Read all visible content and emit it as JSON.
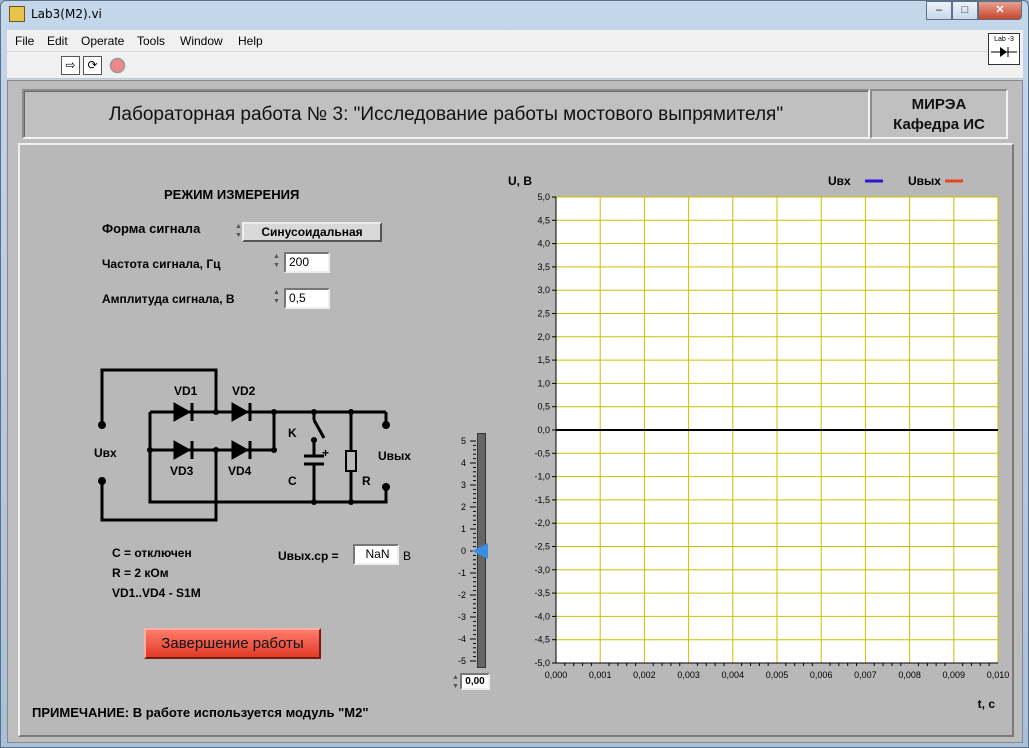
{
  "window": {
    "title": "Lab3(M2).vi",
    "min": "–",
    "max": "□",
    "close": "✕"
  },
  "menu": [
    "File",
    "Edit",
    "Operate",
    "Tools",
    "Window",
    "Help"
  ],
  "vi_icon": "Lab -3",
  "header": {
    "title": "Лабораторная работа № 3: \"Исследование работы мостового выпрямителя\"",
    "org_line1": "МИРЭА",
    "org_line2": "Кафедра ИС"
  },
  "controls": {
    "mode_title": "РЕЖИМ ИЗМЕРЕНИЯ",
    "waveform_label": "Форма сигнала",
    "waveform_value": "Синусоидальная",
    "freq_label": "Частота сигнала, Гц",
    "freq_value": "200",
    "amp_label": "Амплитуда сигнала, В",
    "amp_value": "0,5"
  },
  "circuit": {
    "vd1": "VD1",
    "vd2": "VD2",
    "vd3": "VD3",
    "vd4": "VD4",
    "k": "K",
    "c": "C",
    "r": "R",
    "plus": "+",
    "uin": "Uвх",
    "uout": "Uвых"
  },
  "params": {
    "c_line": "C =   отключен",
    "r_line": "R = 2 кОм",
    "vd_line": "VD1..VD4 - S1M"
  },
  "uavg": {
    "label": "Uвых.ср =",
    "value": "NaN",
    "unit": "B"
  },
  "stop_button": "Завершение работы",
  "note": "ПРИМЕЧАНИЕ: В работе используется модуль \"M2\"",
  "slider": {
    "labels": [
      "5",
      "4",
      "3",
      "2",
      "1",
      "0",
      "-1",
      "-2",
      "-3",
      "-4",
      "-5"
    ],
    "value": 0,
    "digital": "0,00"
  },
  "chart_data": {
    "type": "line",
    "ylabel": "U, B",
    "xlabel": "t, c",
    "ylim": [
      -5.0,
      5.0
    ],
    "xlim": [
      0.0,
      0.01
    ],
    "y_ticks": [
      "5,0",
      "4,5",
      "4,0",
      "3,5",
      "3,0",
      "2,5",
      "2,0",
      "1,5",
      "1,0",
      "0,5",
      "0,0",
      "-0,5",
      "-1,0",
      "-1,5",
      "-2,0",
      "-2,5",
      "-3,0",
      "-3,5",
      "-4,0",
      "-4,5",
      "-5,0"
    ],
    "x_ticks": [
      "0,000",
      "0,001",
      "0,002",
      "0,003",
      "0,004",
      "0,005",
      "0,006",
      "0,007",
      "0,008",
      "0,009",
      "0,010"
    ],
    "grid": true,
    "legend_position": "top-right",
    "series": [
      {
        "name": "Uвх",
        "color": "#2a18d8",
        "x": [
          0.0,
          0.01
        ],
        "y": [
          0.0,
          0.0
        ]
      },
      {
        "name": "Uвых",
        "color": "#e8461e",
        "x": [],
        "y": []
      }
    ],
    "zero_line": 0.0
  },
  "colors": {
    "plot_bg": "#ffffff",
    "grid": "#c8c000",
    "stop_button": "#f05a45",
    "slider_pointer": "#3a8de0"
  }
}
